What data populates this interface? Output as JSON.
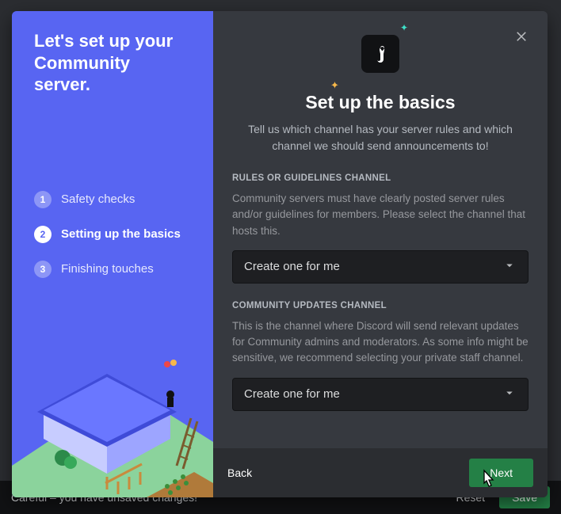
{
  "sidebar": {
    "title": "Let's set up your Community server.",
    "steps": [
      {
        "num": "1",
        "label": "Safety checks"
      },
      {
        "num": "2",
        "label": "Setting up the basics"
      },
      {
        "num": "3",
        "label": "Finishing touches"
      }
    ]
  },
  "main": {
    "title": "Set up the basics",
    "subtitle": "Tell us which channel has your server rules and which channel we should send announcements to!"
  },
  "sections": {
    "rules": {
      "label": "RULES OR GUIDELINES CHANNEL",
      "desc": "Community servers must have clearly posted server rules and/or guidelines for members. Please select the channel that hosts this.",
      "selected": "Create one for me"
    },
    "updates": {
      "label": "COMMUNITY UPDATES CHANNEL",
      "desc": "This is the channel where Discord will send relevant updates for Community admins and moderators. As some info might be sensitive, we recommend selecting your private staff channel.",
      "selected": "Create one for me"
    }
  },
  "footer": {
    "back": "Back",
    "next": "Next"
  },
  "unsaved": {
    "message": "Careful – you have unsaved changes!",
    "reset": "Reset",
    "save": "Save"
  }
}
